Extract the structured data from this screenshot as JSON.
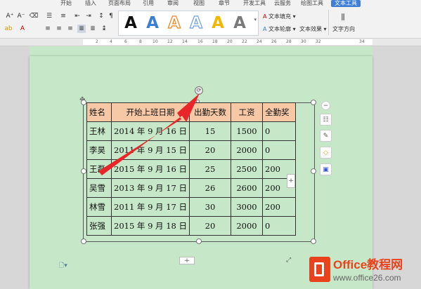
{
  "ribbon": {
    "tabs": [
      "开始",
      "插入",
      "页面布局",
      "引用",
      "审阅",
      "视图",
      "章节",
      "开发工具",
      "云服务",
      "绘图工具",
      "文本工具"
    ],
    "active_tab": "文本工具",
    "text_fill_label": "文本填充",
    "text_outline_label": "文本轮廓",
    "text_effect_label": "文本效果",
    "text_direction_label": "文字方向",
    "gallery_letter": "A",
    "gallery_colors": [
      "#111111",
      "#3a7fd0",
      "#e8841a",
      "#6fa0d8",
      "#f2b800",
      "#7a7a7a"
    ]
  },
  "ruler": {
    "numbers": [
      "2",
      "4",
      "6",
      "8",
      "10",
      "12",
      "14",
      "16",
      "18",
      "20",
      "22",
      "24",
      "26",
      "28",
      "30",
      "32",
      "34"
    ]
  },
  "table": {
    "header": [
      "姓名",
      "开始上班日期",
      "出勤天数",
      "工资",
      "全勤奖"
    ],
    "rows": [
      [
        "王林",
        "2014 年 9 月 16 日",
        "15",
        "1500",
        "0"
      ],
      [
        "李昊",
        "2011 年 9 月 15 日",
        "20",
        "2000",
        "0"
      ],
      [
        "王磊",
        "2015 年 9 月 16 日",
        "25",
        "2500",
        "200"
      ],
      [
        "吴雪",
        "2013 年 9 月 17 日",
        "26",
        "2600",
        "200"
      ],
      [
        "林雪",
        "2011 年 9 月 17 日",
        "30",
        "3000",
        "200"
      ],
      [
        "张强",
        "2015 年 9 月 18 日",
        "20",
        "2000",
        "0"
      ]
    ]
  },
  "controls": {
    "add_row_symbol": "+",
    "add_col_symbol": "+"
  },
  "watermark": {
    "title": "Office教程网",
    "url": "www.office26.com"
  },
  "colors": {
    "page_bg": "#c6e8c8",
    "header_fill": "#f7c8a6",
    "arrow": "#e8262a",
    "accent": "#3d7fd6"
  }
}
